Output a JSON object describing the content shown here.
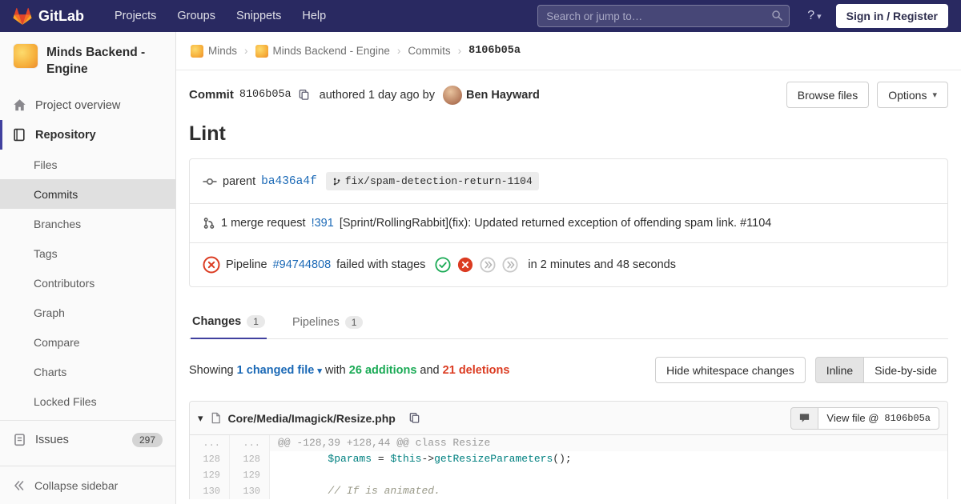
{
  "colors": {
    "navbar_bg": "#292961",
    "accent": "#41419f",
    "link": "#1b69b6",
    "success": "#1aaa55",
    "danger": "#db3b21",
    "brand_orange": "#e24329"
  },
  "icons": {
    "chevron_down": "▾",
    "help": "?"
  },
  "navbar": {
    "brand": "GitLab",
    "menu": [
      "Projects",
      "Groups",
      "Snippets",
      "Help"
    ],
    "search_placeholder": "Search or jump to…",
    "sign_in_label": "Sign in / Register"
  },
  "sidebar": {
    "project_name": "Minds Backend - Engine",
    "project_overview": "Project overview",
    "repository": "Repository",
    "repo_subitems": [
      "Files",
      "Commits",
      "Branches",
      "Tags",
      "Contributors",
      "Graph",
      "Compare",
      "Charts",
      "Locked Files"
    ],
    "issues": "Issues",
    "issues_count": "297",
    "collapse": "Collapse sidebar"
  },
  "breadcrumb": {
    "separator": "›",
    "items": [
      "Minds",
      "Minds Backend - Engine",
      "Commits",
      "8106b05a"
    ]
  },
  "commit": {
    "label": "Commit",
    "sha": "8106b05a",
    "authored_text": "authored 1 day ago by",
    "author": "Ben Hayward",
    "browse_files_label": "Browse files",
    "options_label": "Options",
    "title": "Lint",
    "parent_label": "parent",
    "parent_sha": "ba436a4f",
    "branch_name": "fix/spam-detection-return-1104",
    "mr_text": "1 merge request",
    "mr_ref": "!391",
    "mr_title": "[Sprint/RollingRabbit](fix): Updated returned exception of offending spam link. #1104",
    "pipeline_label": "Pipeline",
    "pipeline_id": "#94744808",
    "pipeline_status_text": "failed with stages",
    "pipeline_duration_text": "in 2 minutes and 48 seconds"
  },
  "tabs": {
    "changes_label": "Changes",
    "changes_count": "1",
    "pipelines_label": "Pipelines",
    "pipelines_count": "1"
  },
  "summary": {
    "showing": "Showing",
    "changed_file": "1 changed file",
    "with": "with",
    "additions": "26 additions",
    "and": "and",
    "deletions": "21 deletions",
    "hide_whitespace_label": "Hide whitespace changes",
    "inline_label": "Inline",
    "side_by_side_label": "Side-by-side"
  },
  "diff": {
    "filename": "Core/Media/Imagick/Resize.php",
    "view_file_prefix": "View file @",
    "view_file_sha": "8106b05a",
    "meta_old": "...",
    "meta_new": "...",
    "meta_text": "@@ -128,39 +128,44 @@ class Resize",
    "rows": [
      {
        "old": "128",
        "new": "128"
      },
      {
        "old": "129",
        "new": "129"
      },
      {
        "old": "130",
        "new": "130"
      }
    ],
    "code": {
      "indent": "        ",
      "var_params": "$params",
      "assign": " = ",
      "var_this": "$this",
      "arrow": "->",
      "method": "getResizeParameters",
      "call_end": "();",
      "comment": "// If is animated."
    }
  }
}
